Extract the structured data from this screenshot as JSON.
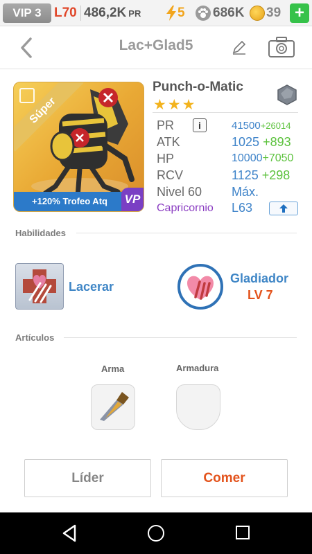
{
  "status_bar": {
    "vip": "VIP 3",
    "level": "L70",
    "power_total": "486,2K",
    "power_unit": "PR",
    "energy": "5",
    "food": "686K",
    "coins": "39",
    "add_symbol": "+"
  },
  "header": {
    "title": "Lac+Glad5"
  },
  "monster": {
    "name": "Punch-o-Matic",
    "stars": "★★★",
    "rarity_ribbon": "Súper",
    "card_bonus": "+120% Trofeo Atq",
    "badge": "VP",
    "element": "metal",
    "stats": {
      "pr_label": "PR",
      "pr_value": "41500",
      "pr_bonus": "+26014",
      "atk_label": "ATK",
      "atk_value": "1025",
      "atk_bonus": "+893",
      "hp_label": "HP",
      "hp_value": "10000",
      "hp_bonus": "+7050",
      "rcv_label": "RCV",
      "rcv_value": "1125",
      "rcv_bonus": "+298",
      "level_label": "Nivel 60",
      "level_value": "Máx.",
      "zodiac_label": "Capricornio",
      "zodiac_level": "L63"
    }
  },
  "sections": {
    "abilities": "Habilidades",
    "items": "Artículos"
  },
  "abilities": [
    {
      "name": "Lacerar"
    },
    {
      "name": "Gladiador",
      "level": "LV 7"
    }
  ],
  "items": {
    "weapon_label": "Arma",
    "armor_label": "Armadura"
  },
  "buttons": {
    "leader": "Líder",
    "eat": "Comer"
  },
  "colors": {
    "accent_blue": "#3e83c9",
    "bonus_green": "#5cc23d",
    "action_orange": "#e3531c",
    "zodiac_purple": "#8b3dc2",
    "star_gold": "#f3b31d"
  }
}
